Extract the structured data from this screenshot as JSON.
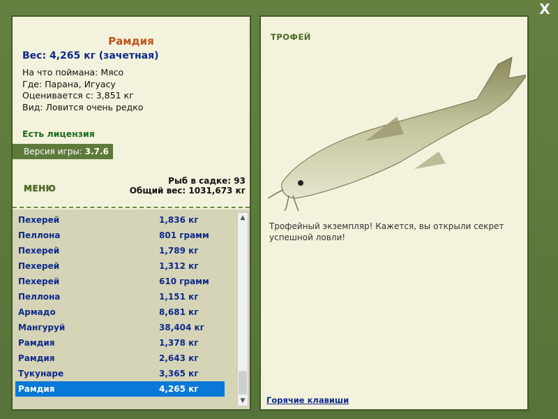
{
  "window": {
    "close_label": "X"
  },
  "fish": {
    "name": "Рамдия",
    "weight": "Вес: 4,265 кг (зачетная)",
    "caught_on": "На что поймана: Мясо",
    "where": "Где: Парана, Игуасу",
    "valued_from": "Оценивается с: 3,851 кг",
    "kind": "Вид: Ловится очень редко"
  },
  "license": "Есть лицензия",
  "version": {
    "label": "Версия игры: ",
    "number": "3.7.6"
  },
  "menu_label": "МЕНЮ",
  "stats": {
    "fish_count": "Рыб в садке: 93",
    "total_weight": "Общий вес: 1031,673 кг"
  },
  "catch_list": [
    {
      "name": "Пехерей",
      "weight": "1,836 кг"
    },
    {
      "name": "Пеллона",
      "weight": "801 грамм"
    },
    {
      "name": "Пехерей",
      "weight": "1,789 кг"
    },
    {
      "name": "Пехерей",
      "weight": "1,312 кг"
    },
    {
      "name": "Пехерей",
      "weight": "610 грамм"
    },
    {
      "name": "Пеллона",
      "weight": "1,151 кг"
    },
    {
      "name": "Армадо",
      "weight": "8,681 кг"
    },
    {
      "name": "Мангуруй",
      "weight": "38,404 кг"
    },
    {
      "name": "Рамдия",
      "weight": "1,378 кг"
    },
    {
      "name": "Рамдия",
      "weight": "2,643 кг"
    },
    {
      "name": "Тукунаре",
      "weight": "3,365 кг"
    },
    {
      "name": "Рамдия",
      "weight": "4,265 кг"
    }
  ],
  "selected_index": 11,
  "trophy_label": "ТРОФЕЙ",
  "trophy_message": "Трофейный экземпляр! Кажется, вы открыли секрет успешной ловли!",
  "hotkeys_link": "Горячие клавиши",
  "colors": {
    "frame": "#5d7a3a",
    "panel": "#f3f2dc",
    "selection": "#0a78d7",
    "title": "#c0531a",
    "link": "#0d2a8c"
  }
}
